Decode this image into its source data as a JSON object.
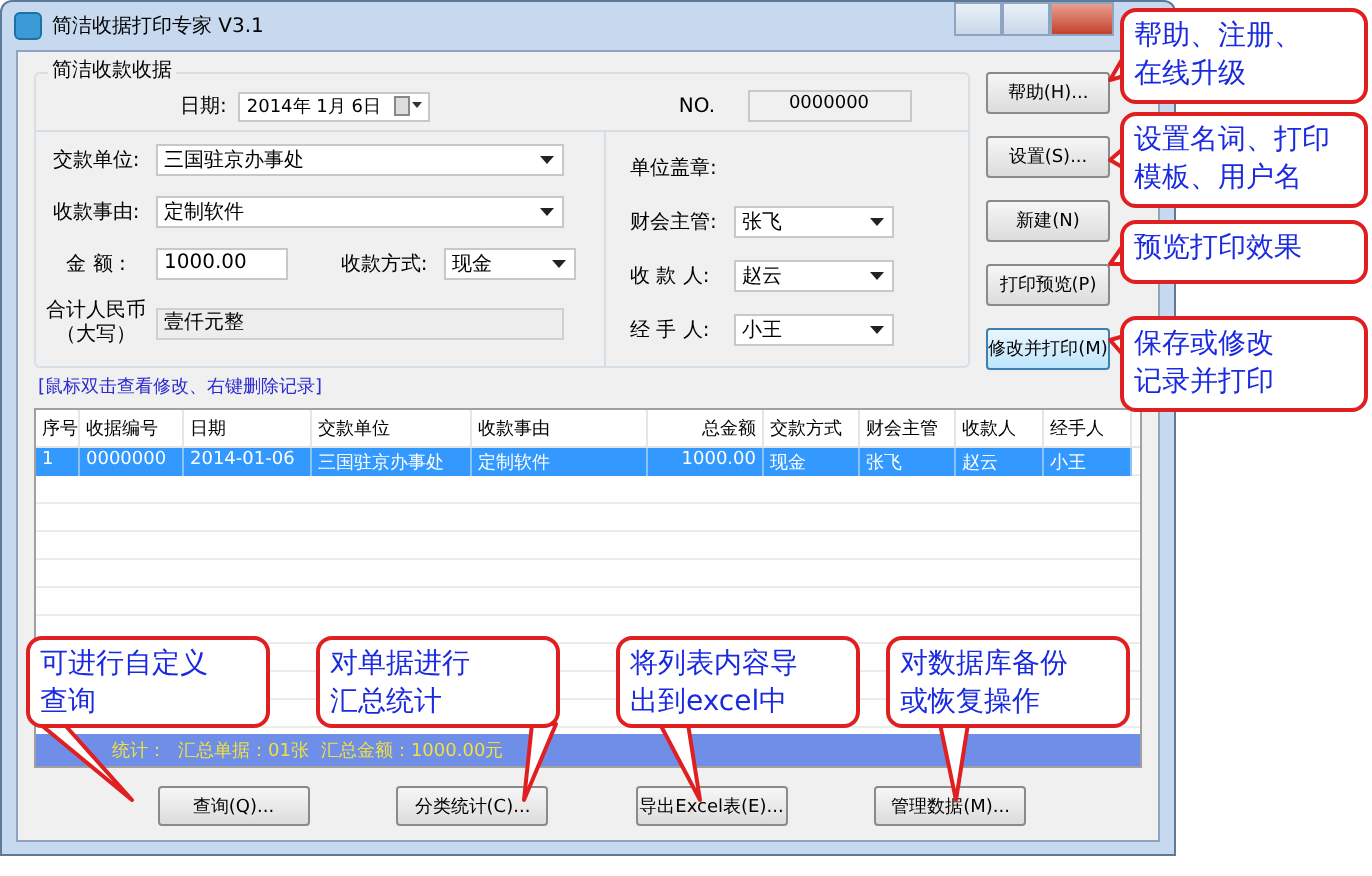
{
  "window": {
    "title": "简洁收据打印专家 V3.1"
  },
  "form": {
    "group_title": "简洁收款收据",
    "date_label": "日期:",
    "date_value": "2014年 1月 6日",
    "no_label": "NO.",
    "no_value": "0000000",
    "payer": {
      "label": "交款单位:",
      "value": "三国驻京办事处"
    },
    "reason": {
      "label": "收款事由:",
      "value": "定制软件"
    },
    "amount": {
      "label": "金    额 :",
      "value": "1000.00"
    },
    "method": {
      "label": "收款方式:",
      "value": "现金"
    },
    "total": {
      "label": [
        "合计人民币",
        "（大写）"
      ],
      "value": "壹仟元整"
    },
    "seal_label": "单位盖章:",
    "people": [
      {
        "label": "财会主管:",
        "value": "张飞"
      },
      {
        "label": "收 款 人:",
        "value": "赵云"
      },
      {
        "label": "经 手 人:",
        "value": "小王"
      }
    ]
  },
  "side_buttons": [
    {
      "label": "帮助(H)...",
      "default": false
    },
    {
      "label": "设置(S)...",
      "default": false
    },
    {
      "label": "新建(N)",
      "default": false
    },
    {
      "label": "打印预览(P)",
      "default": false
    },
    {
      "label": "修改并打印(M)",
      "default": true
    }
  ],
  "hint": "[鼠标双击查看修改、右键删除记录]",
  "table": {
    "columns": [
      "序号",
      "收据编号",
      "日期",
      "交款单位",
      "收款事由",
      "总金额",
      "交款方式",
      "财会主管",
      "收款人",
      "经手人"
    ],
    "rows": [
      {
        "selected": true,
        "cells": [
          "1",
          "0000000",
          "2014-01-06",
          "三国驻京办事处",
          "定制软件",
          "1000.00",
          "现金",
          "张飞",
          "赵云",
          "小王"
        ]
      }
    ]
  },
  "status_bar": {
    "label": "统计：",
    "count": "汇总单据：01张",
    "sum": "汇总金额：1000.00元"
  },
  "bottom_buttons": [
    "查询(Q)...",
    "分类统计(C)...",
    "导出Excel表(E)...",
    "管理数据(M)..."
  ],
  "callouts": [
    {
      "lines": [
        "帮助、注册、",
        "在线升级"
      ]
    },
    {
      "lines": [
        "设置名词、打印",
        "模板、用户名"
      ]
    },
    {
      "lines": [
        "预览打印效果"
      ]
    },
    {
      "lines": [
        "保存或修改",
        "记录并打印"
      ]
    },
    {
      "lines": [
        "可进行自定义",
        "查询"
      ]
    },
    {
      "lines": [
        "对单据进行",
        "汇总统计"
      ]
    },
    {
      "lines": [
        "将列表内容导",
        "出到excel中"
      ]
    },
    {
      "lines": [
        "对数据库备份",
        "或恢复操作"
      ]
    }
  ]
}
